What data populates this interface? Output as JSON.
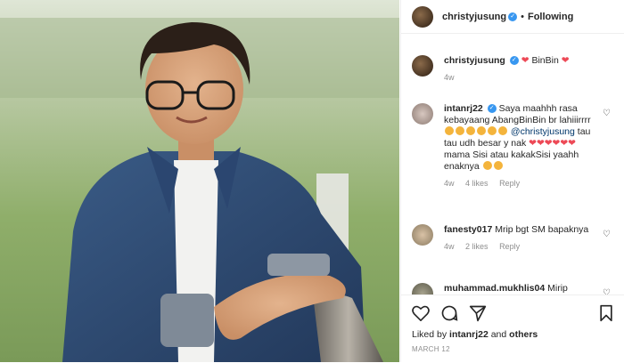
{
  "post": {
    "username": "christyjusung",
    "follow_label": "Following",
    "caption": "BinBin",
    "caption_age": "4w"
  },
  "comments": [
    {
      "user": "intanrj22",
      "text_a": "Saya maahhh rasa kebayaang AbangBinBin br lahiiirrrr",
      "mention": "@christyjusung",
      "text_b": "tau tau udh besar y nak",
      "text_c": "mama Sisi atau kakakSisi yaahh enaknya",
      "age": "4w",
      "likes": "4 likes",
      "reply": "Reply"
    },
    {
      "user": "fanesty017",
      "text": "Mrip bgt SM bapaknya",
      "age": "4w",
      "likes": "2 likes",
      "reply": "Reply"
    },
    {
      "user": "muhammad.mukhlis04",
      "text": "Mirip"
    }
  ],
  "liked_by": {
    "prefix": "Liked by",
    "user": "intanrj22",
    "and": "and",
    "others": "others"
  },
  "date": "MARCH 12",
  "icons": {
    "like": "heart-icon",
    "comment": "comment-icon",
    "share": "share-icon",
    "save": "bookmark-icon"
  }
}
